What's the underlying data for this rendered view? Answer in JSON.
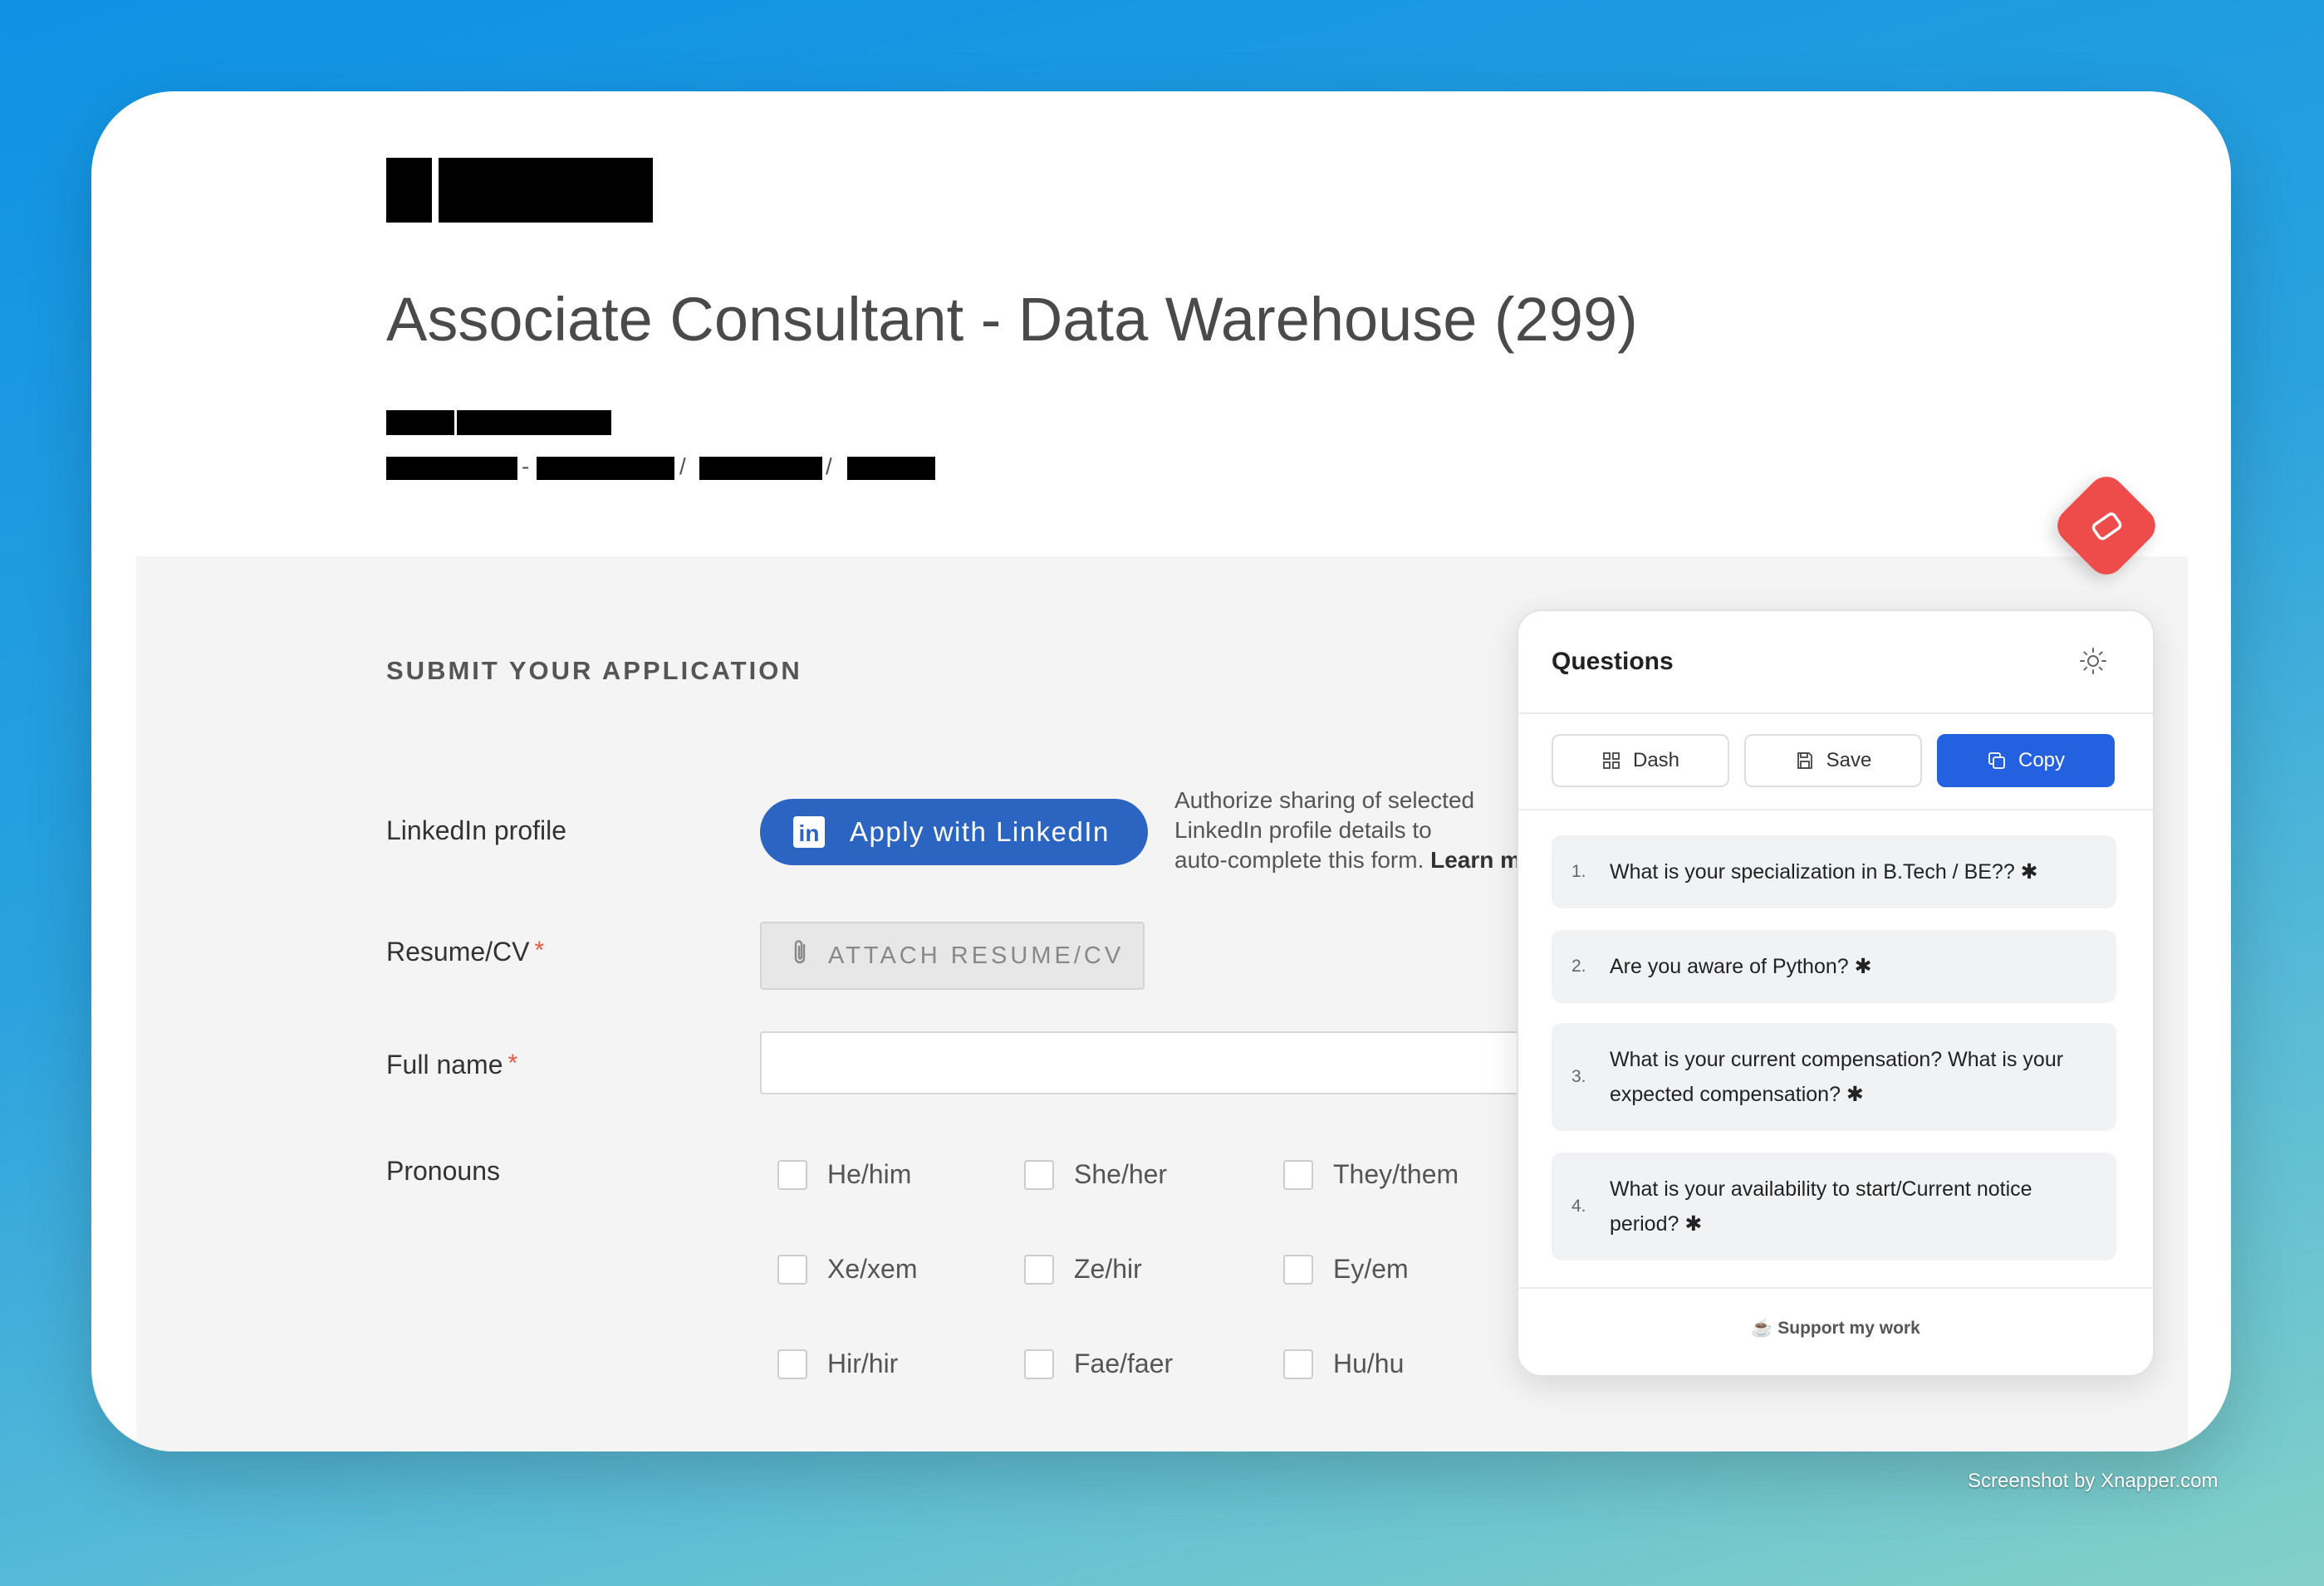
{
  "job": {
    "title": "Associate Consultant - Data Warehouse (299)"
  },
  "breadcrumb_separators": [
    "-",
    "/",
    "/"
  ],
  "form": {
    "section_title": "SUBMIT YOUR APPLICATION",
    "linkedin": {
      "label": "LinkedIn profile",
      "button": "Apply with LinkedIn",
      "logo_text": "in",
      "help_line1": "Authorize sharing of selected",
      "help_line2": "LinkedIn profile details to",
      "help_line3": "auto-complete this form.",
      "help_link": "Learn m"
    },
    "resume": {
      "label": "Resume/CV",
      "required_mark": "*",
      "button": "ATTACH RESUME/CV"
    },
    "full_name": {
      "label": "Full name",
      "required_mark": "*",
      "value": ""
    },
    "pronouns": {
      "label": "Pronouns",
      "options": [
        "He/him",
        "She/her",
        "They/them",
        "Xe/xem",
        "Ze/hir",
        "Ey/em",
        "Hir/hir",
        "Fae/faer",
        "Hu/hu"
      ]
    }
  },
  "extension": {
    "title": "Questions",
    "toolbar": {
      "dash": "Dash",
      "save": "Save",
      "copy": "Copy"
    },
    "questions": [
      {
        "num": "1.",
        "text": "What is your specialization in B.Tech / BE?? ✱"
      },
      {
        "num": "2.",
        "text": "Are you aware of Python? ✱"
      },
      {
        "num": "3.",
        "text": "What is your current compensation? What is your expected compensation? ✱"
      },
      {
        "num": "4.",
        "text": "What is your availability to start/Current notice period? ✱"
      }
    ],
    "support": "☕ Support my work"
  },
  "credit": "Screenshot by Xnapper.com",
  "colors": {
    "linkedin": "#2b65c1",
    "primary": "#2361e0",
    "fab": "#ee4b4b",
    "required": "#e8583e"
  }
}
